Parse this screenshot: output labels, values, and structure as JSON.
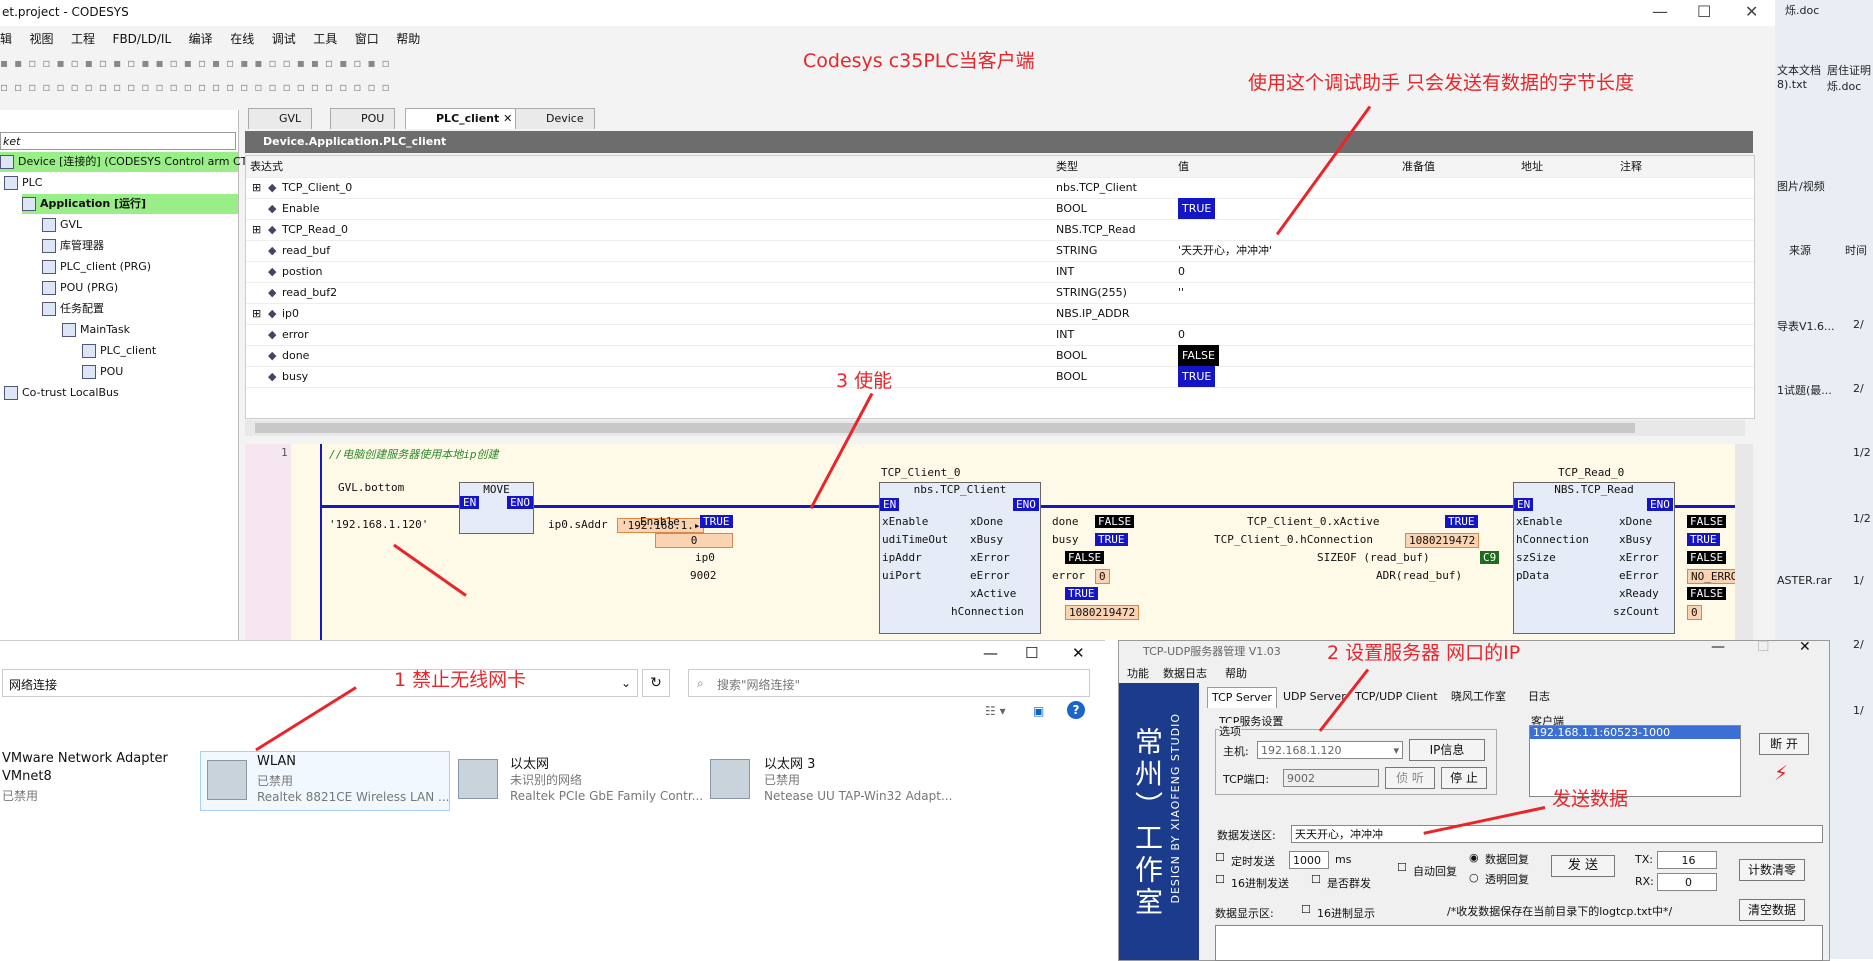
{
  "window": {
    "title": "et.project - CODESYS",
    "min": "—",
    "max": "☐",
    "close": "✕"
  },
  "menu": [
    "辑",
    "视图",
    "工程",
    "FBD/LD/IL",
    "编译",
    "在线",
    "调试",
    "工具",
    "窗口",
    "帮助"
  ],
  "annotations": {
    "headline": "Codesys c35PLC当客户端",
    "debug_note": "使用这个调试助手 只会发送有数据的字节长度",
    "enable_note": "3 使能",
    "wlan_note": "1 禁止无线网卡",
    "server_note": "2 设置服务器 网口的IP",
    "send_note": "发送数据"
  },
  "tree": {
    "filter": "ket",
    "items": [
      {
        "label": "Device [连接的] (CODESYS Control arm CTH3",
        "highlight": true
      },
      {
        "label": "PLC"
      },
      {
        "label": "Application [运行]",
        "highlight": true
      },
      {
        "label": "GVL"
      },
      {
        "label": "库管理器"
      },
      {
        "label": "PLC_client (PRG)"
      },
      {
        "label": "POU (PRG)"
      },
      {
        "label": "任务配置"
      },
      {
        "label": "MainTask"
      },
      {
        "label": "PLC_client"
      },
      {
        "label": "POU"
      },
      {
        "label": "Co-trust LocalBus"
      }
    ]
  },
  "tabs": [
    {
      "label": "GVL"
    },
    {
      "label": "POU"
    },
    {
      "label": "PLC_client",
      "active": true,
      "close": "✕"
    },
    {
      "label": "Device"
    }
  ],
  "editor_path": "Device.Application.PLC_client",
  "watch": {
    "headers": [
      "表达式",
      "类型",
      "值",
      "准备值",
      "地址",
      "注释"
    ],
    "rows": [
      {
        "expr": "TCP_Client_0",
        "type": "nbs.TCP_Client",
        "value": "",
        "expand": "⊞"
      },
      {
        "expr": "Enable",
        "type": "BOOL",
        "value": "TRUE",
        "style": "blue"
      },
      {
        "expr": "TCP_Read_0",
        "type": "NBS.TCP_Read",
        "value": "",
        "expand": "⊞"
      },
      {
        "expr": "read_buf",
        "type": "STRING",
        "value": "'天天开心，冲冲冲'"
      },
      {
        "expr": "postion",
        "type": "INT",
        "value": "0"
      },
      {
        "expr": "read_buf2",
        "type": "STRING(255)",
        "value": "''"
      },
      {
        "expr": "ip0",
        "type": "NBS.IP_ADDR",
        "value": "",
        "expand": "⊞"
      },
      {
        "expr": "error",
        "type": "INT",
        "value": "0"
      },
      {
        "expr": "done",
        "type": "BOOL",
        "value": "FALSE",
        "style": "black"
      },
      {
        "expr": "busy",
        "type": "BOOL",
        "value": "TRUE",
        "style": "blue"
      }
    ]
  },
  "fbd": {
    "line_no": "1",
    "comment": "//电脑创建服务器使用本地ip创建",
    "move": {
      "input_var": "GVL.bottom",
      "title": "MOVE",
      "en": "EN",
      "eno": "ENO",
      "ip_literal": "'192.168.1.120'",
      "out": "ip0.sAddr",
      "out_val": "'192.168.1.▸"
    },
    "client": {
      "instance": "TCP_Client_0",
      "type": "nbs.TCP_Client",
      "en": "EN",
      "eno": "ENO",
      "inputs": [
        {
          "pin": "xEnable",
          "src": "Enable",
          "val": "TRUE"
        },
        {
          "pin": "udiTimeOut",
          "src": "",
          "val": "0"
        },
        {
          "pin": "ipAddr",
          "src": "ip0",
          "val": ""
        },
        {
          "pin": "uiPort",
          "src": "9002",
          "val": ""
        }
      ],
      "outputs": [
        {
          "pin": "xDone",
          "dst": "done",
          "val": "FALSE"
        },
        {
          "pin": "xBusy",
          "dst": "busy",
          "val": "TRUE"
        },
        {
          "pin": "xError",
          "dst": "",
          "val": "FALSE"
        },
        {
          "pin": "eError",
          "dst": "error",
          "val": "0"
        },
        {
          "pin": "xActive",
          "dst": "",
          "val": "TRUE"
        },
        {
          "pin": "hConnection",
          "dst": "",
          "val": "1080219472"
        }
      ]
    },
    "read": {
      "instance": "TCP_Read_0",
      "type": "NBS.TCP_Read",
      "en": "EN",
      "eno": "ENO",
      "inputs": [
        {
          "pin": "xEnable",
          "src": "TCP_Client_0.xActive",
          "val": "TRUE"
        },
        {
          "pin": "hConnection",
          "src": "TCP_Client_0.hConnection",
          "val": "1080219472"
        },
        {
          "pin": "szSize",
          "src": "SIZEOF (read_buf)",
          "val": "C9"
        },
        {
          "pin": "pData",
          "src": "ADR(read_buf)",
          "val": ""
        }
      ],
      "outputs": [
        {
          "pin": "xDone",
          "val": "FALSE"
        },
        {
          "pin": "xBusy",
          "val": "TRUE"
        },
        {
          "pin": "xError",
          "val": "FALSE"
        },
        {
          "pin": "eError",
          "val": "NO_ERROR"
        },
        {
          "pin": "xReady",
          "val": "FALSE"
        },
        {
          "pin": "szCount",
          "val": "0"
        }
      ]
    }
  },
  "network": {
    "address": "网络连接",
    "search_placeholder": "搜索\"网络连接\"",
    "refresh": "↻",
    "adapters": [
      {
        "name": "VMware Network Adapter",
        "line2": "VMnet8",
        "line3": "已禁用"
      },
      {
        "name": "WLAN",
        "line2": "已禁用",
        "line3": "Realtek 8821CE Wireless LAN ..."
      },
      {
        "name": "以太网",
        "line2": "未识别的网络",
        "line3": "Realtek PCIe GbE Family Contr..."
      },
      {
        "name": "以太网 3",
        "line2": "已禁用",
        "line3": "Netease UU TAP-Win32 Adapt..."
      }
    ]
  },
  "tcp": {
    "title": "TCP-UDP服务器管理 V1.03",
    "menu": [
      "功能",
      "数据日志",
      "帮助"
    ],
    "tabs": [
      "TCP Server",
      "UDP Server",
      "TCP/UDP Client",
      "晓风工作室",
      "日志"
    ],
    "sidebar_cn": "常州）工作室",
    "sidebar_en": "DESIGN BY XIAOFENG STUDIO",
    "group": "TCP服务设置",
    "options": "选项",
    "host_label": "主机:",
    "host": "192.168.1.120",
    "ipinfo": "IP信息",
    "port_label": "TCP端口:",
    "port": "9002",
    "listen": "侦 听",
    "stop": "停 止",
    "client_group": "客户端",
    "client_entry": "192.168.1.1:60523-1000",
    "disconnect": "断 开",
    "send_label": "数据发送区:",
    "send_text": "天天开心，冲冲冲",
    "timer_label": "定时发送",
    "timer_val": "1000",
    "ms": "ms",
    "auto_reply": "自动回复",
    "data_reply": "数据回复",
    "trans_reply": "透明回复",
    "send_btn": "发 送",
    "tx_label": "TX:",
    "tx": "16",
    "rx_label": "RX:",
    "rx": "0",
    "clear_count": "计数清零",
    "hex_send": "16进制发送",
    "group_send": "是否群发",
    "display_label": "数据显示区:",
    "hex_display": "16进制显示",
    "log_note": "/*收发数据保存在当前目录下的logtcp.txt中*/",
    "clear_data": "清空数据"
  },
  "desktop": {
    "items": [
      "文本文档",
      "居住证明",
      "8).txt",
      "烁.doc",
      "图片/视频",
      "来源",
      "时间",
      "导表V1.6...",
      "2/",
      "1试题(最...",
      "2/",
      "1/2",
      "1/2",
      "ASTER.rar",
      "1/",
      "2/",
      "1/"
    ],
    "top_label": "烁.doc"
  }
}
